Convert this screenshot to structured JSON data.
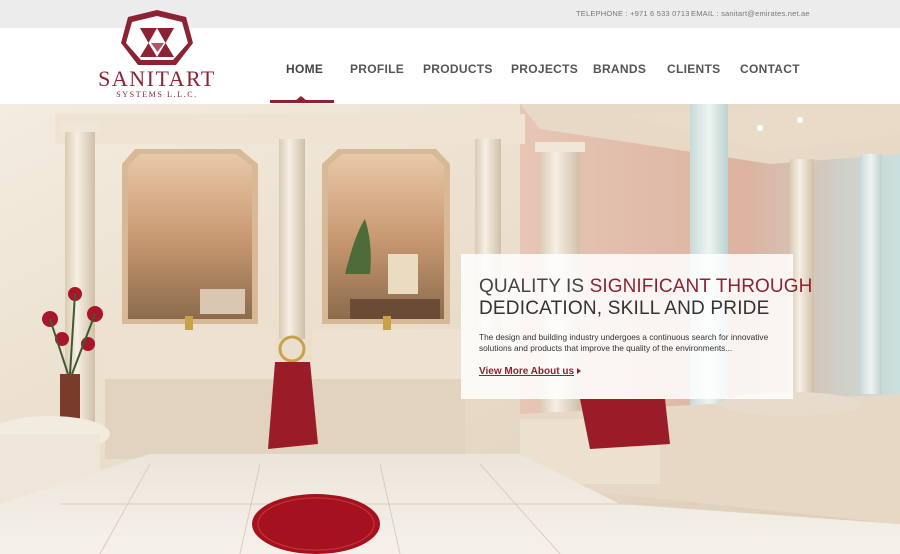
{
  "topbar": {
    "telephone": "TELEPHONE : +971 6 533 0713",
    "email": "EMAIL : sanitart@emirates.net.ae"
  },
  "logo": {
    "name": "SANITART",
    "subtitle": "SYSTEMS L.L.C."
  },
  "nav": {
    "items": [
      {
        "label": "HOME",
        "active": true
      },
      {
        "label": "PROFILE",
        "active": false
      },
      {
        "label": "PRODUCTS",
        "active": false
      },
      {
        "label": "PROJECTS",
        "active": false
      },
      {
        "label": "BRANDS",
        "active": false
      },
      {
        "label": "CLIENTS",
        "active": false
      },
      {
        "label": "CONTACT",
        "active": false
      }
    ]
  },
  "hero": {
    "headline_part1": "QUALITY IS",
    "headline_accent": "SIGNIFICANT THROUGH",
    "headline_line2": "DEDICATION, SKILL AND PRIDE",
    "body": "The design and building industry undergoes a continuous search for innovative solutions and products that improve the quality of the environments...",
    "link": "View More About us"
  },
  "colors": {
    "accent": "#8c2335",
    "topbar": "#ececec",
    "nav_text": "#555555"
  }
}
